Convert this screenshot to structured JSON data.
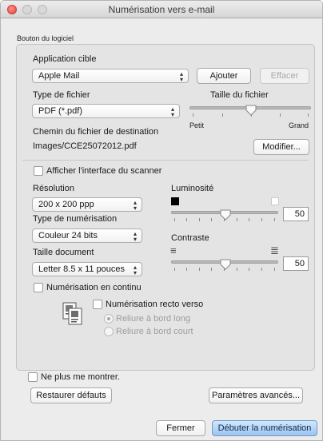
{
  "window": {
    "title": "Numérisation vers e-mail"
  },
  "group_label": "Bouton du logiciel",
  "target_app": {
    "label": "Application cible",
    "value": "Apple Mail",
    "add_button": "Ajouter",
    "remove_button": "Effacer"
  },
  "file_type": {
    "label": "Type de fichier",
    "value": "PDF (*.pdf)"
  },
  "file_size": {
    "label": "Taille du fichier",
    "min_label": "Petit",
    "max_label": "Grand",
    "level": 0.6
  },
  "destination": {
    "label": "Chemin du fichier de destination",
    "path": "Images/CCE25072012.pdf",
    "modify_button": "Modifier..."
  },
  "show_scanner_ui": {
    "label": "Afficher l'interface du scanner",
    "checked": false
  },
  "resolution": {
    "label": "Résolution",
    "value": "200 x 200 ppp"
  },
  "scan_type": {
    "label": "Type de numérisation",
    "value": "Couleur 24 bits"
  },
  "document_size": {
    "label": "Taille document",
    "value": "Letter 8.5 x 11 pouces"
  },
  "brightness": {
    "label": "Luminosité",
    "value": "50",
    "level": 0.5
  },
  "contrast": {
    "label": "Contraste",
    "value": "50",
    "level": 0.5
  },
  "continuous_scan": {
    "label": "Numérisation en continu",
    "checked": false
  },
  "duplex": {
    "label": "Numérisation recto verso",
    "checked": false,
    "options": [
      "Reliure à bord long",
      "Reliure à bord court"
    ],
    "selected_index": 0,
    "icon": "duplex-pages-icon"
  },
  "dont_show": {
    "label": "Ne plus me montrer.",
    "checked": false
  },
  "footer": {
    "restore_button": "Restaurer défauts",
    "advanced_button": "Paramètres avancés...",
    "close_button": "Fermer",
    "start_button": "Débuter la numérisation"
  },
  "colors": {
    "accent_button": "#9cc4ee",
    "close_light": "#e0443e"
  }
}
